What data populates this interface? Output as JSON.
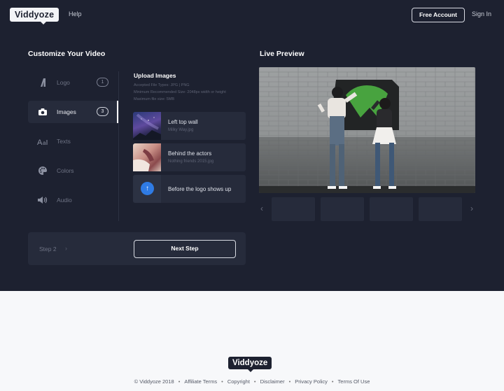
{
  "header": {
    "logo": "Viddyoze",
    "help": "Help",
    "free_account": "Free Account",
    "sign_in": "Sign In"
  },
  "customize": {
    "title": "Customize Your Video",
    "menu": [
      {
        "label": "Logo",
        "count": "1",
        "icon": "logo-icon",
        "active": false
      },
      {
        "label": "Images",
        "count": "3",
        "icon": "camera-icon",
        "active": true
      },
      {
        "label": "Texts",
        "count": "",
        "icon": "text-icon",
        "active": false
      },
      {
        "label": "Colors",
        "count": "",
        "icon": "palette-icon",
        "active": false
      },
      {
        "label": "Audio",
        "count": "",
        "icon": "speaker-icon",
        "active": false
      }
    ]
  },
  "upload": {
    "title": "Upload Images",
    "meta": [
      "Accepted File Types: JPG | PNG",
      "Minimum Recommended Size: 2048px width or height",
      "Maximum file size: 5MB"
    ],
    "images": [
      {
        "name": "Left top wall",
        "sub": "Milky Way.jpg"
      },
      {
        "name": "Behind the actors",
        "sub": "Nothing friends 2015.jpg"
      },
      {
        "name": "Before the logo shows up",
        "sub": ""
      }
    ]
  },
  "step": {
    "label": "Step 2",
    "next": "Next Step"
  },
  "preview": {
    "title": "Live Preview"
  },
  "footer": {
    "logo": "Viddyoze",
    "copyright": "© Viddyoze 2018",
    "links": [
      "Affiliate Terms",
      "Copyright",
      "Disclaimer",
      "Privacy Policy",
      "Terms Of Use"
    ]
  },
  "colors": {
    "app_bg": "#1d2130",
    "panel_bg": "#262b3b",
    "accent_blue": "#2f7be4",
    "page_bg": "#f7f8fa"
  }
}
